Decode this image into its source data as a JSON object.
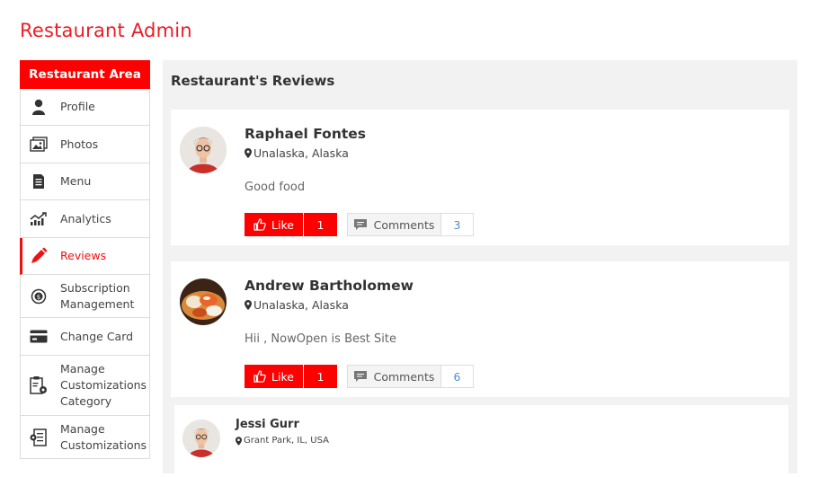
{
  "page_title": "Restaurant Admin",
  "sidebar": {
    "header": "Restaurant Area",
    "items": [
      {
        "label": "Profile",
        "icon": "user-icon"
      },
      {
        "label": "Photos",
        "icon": "photos-icon"
      },
      {
        "label": "Menu",
        "icon": "menu-doc-icon"
      },
      {
        "label": "Analytics",
        "icon": "analytics-icon"
      },
      {
        "label": "Reviews",
        "icon": "pen-icon",
        "active": true
      },
      {
        "label": "Subscription Management",
        "icon": "subscription-icon"
      },
      {
        "label": "Change Card",
        "icon": "card-icon"
      },
      {
        "label": "Manage Customizations Category",
        "icon": "clipboard-gear-icon"
      },
      {
        "label": "Manage Customizations",
        "icon": "list-gear-icon"
      }
    ]
  },
  "main": {
    "title": "Restaurant's Reviews",
    "reviews": [
      {
        "name": "Raphael Fontes",
        "location": "Unalaska, Alaska",
        "text": "Good food",
        "like_label": "Like",
        "likes": "1",
        "comments_label": "Comments",
        "comments": "3"
      },
      {
        "name": "Andrew Bartholomew",
        "location": "Unalaska, Alaska",
        "text": "Hii , NowOpen is Best Site",
        "like_label": "Like",
        "likes": "1",
        "comments_label": "Comments",
        "comments": "6"
      }
    ],
    "sub_review": {
      "name": "Jessi Gurr",
      "location": "Grant Park, IL, USA"
    }
  },
  "colors": {
    "accent": "#ff0000",
    "count_blue": "#4a8fcb",
    "panel_bg": "#f2f2f2"
  }
}
